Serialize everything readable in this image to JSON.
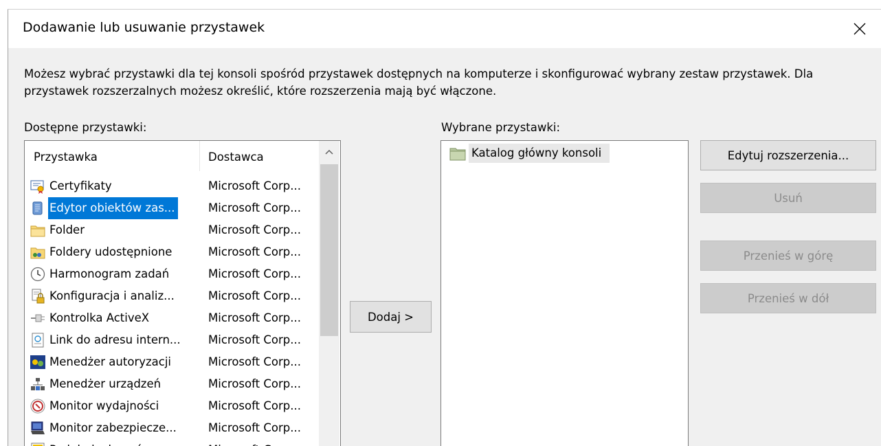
{
  "dialog": {
    "title": "Dodawanie lub usuwanie przystawek",
    "description": "Możesz wybrać przystawki dla tej konsoli spośród przystawek dostępnych na komputerze i skonfigurować wybrany zestaw przystawek. Dla przystawek rozszerzalnych możesz określić, które rozszerzenia mają być włączone.",
    "available_label": "Dostępne przystawki:",
    "selected_label": "Wybrane przystawki:"
  },
  "available": {
    "columns": [
      "Przystawka",
      "Dostawca"
    ],
    "rows": [
      {
        "name": "Certyfikaty",
        "vendor": "Microsoft Corp...",
        "icon": "certificate-icon"
      },
      {
        "name": "Edytor obiektów zas...",
        "vendor": "Microsoft Corp...",
        "icon": "policy-scroll-icon",
        "selected": true
      },
      {
        "name": "Folder",
        "vendor": "Microsoft Corp...",
        "icon": "folder-icon"
      },
      {
        "name": "Foldery udostępnione",
        "vendor": "Microsoft Corp...",
        "icon": "shared-folder-icon"
      },
      {
        "name": "Harmonogram zadań",
        "vendor": "Microsoft Corp...",
        "icon": "clock-icon"
      },
      {
        "name": "Konfiguracja i analiz...",
        "vendor": "Microsoft Corp...",
        "icon": "security-config-icon"
      },
      {
        "name": "Kontrolka ActiveX",
        "vendor": "Microsoft Corp...",
        "icon": "activex-icon"
      },
      {
        "name": "Link do adresu intern...",
        "vendor": "Microsoft Corp...",
        "icon": "web-link-icon"
      },
      {
        "name": "Menedżer autoryzacji",
        "vendor": "Microsoft Corp...",
        "icon": "authorization-icon"
      },
      {
        "name": "Menedżer urządzeń",
        "vendor": "Microsoft Corp...",
        "icon": "device-manager-icon"
      },
      {
        "name": "Monitor wydajności",
        "vendor": "Microsoft Corp...",
        "icon": "performance-icon"
      },
      {
        "name": "Monitor zabezpiecze...",
        "vendor": "Microsoft Corp...",
        "icon": "security-monitor-icon"
      },
      {
        "name": "Podgląd zdarzeń",
        "vendor": "Microsoft Corp...",
        "icon": "event-viewer-icon"
      }
    ]
  },
  "selected": {
    "items": [
      {
        "name": "Katalog główny konsoli",
        "icon": "console-root-icon"
      }
    ]
  },
  "buttons": {
    "add": "Dodaj >",
    "edit_extensions": "Edytuj rozszerzenia...",
    "remove": "Usuń",
    "move_up": "Przenieś w górę",
    "move_down": "Przenieś w dół"
  },
  "colors": {
    "selection": "#0078d7",
    "dialog_bg": "#f0f0f0",
    "disabled_button": "#cccccc"
  }
}
